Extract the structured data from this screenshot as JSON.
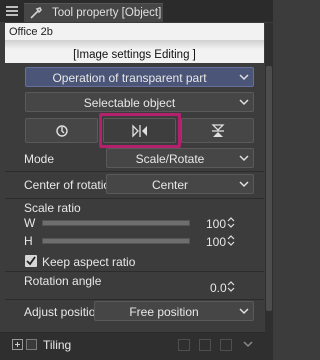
{
  "panel": {
    "tab_title": "Tool property [Object]",
    "preview_name": "Office 2b",
    "preview_caption": "[Image settings Editing ]"
  },
  "operation": {
    "label": "Operation of transparent part"
  },
  "selectable": {
    "label": "Selectable object"
  },
  "mode": {
    "label": "Mode",
    "value": "Scale/Rotate"
  },
  "center": {
    "label": "Center of rotation",
    "value": "Center"
  },
  "scale": {
    "label": "Scale ratio",
    "w_label": "W",
    "w_value": "100",
    "h_label": "H",
    "h_value": "100",
    "keep_aspect_label": "Keep aspect ratio",
    "keep_aspect_checked": true
  },
  "rotation": {
    "label": "Rotation angle",
    "value": "0.0"
  },
  "adjust": {
    "label": "Adjust position",
    "value": "Free position"
  },
  "tiling": {
    "label": "Tiling"
  },
  "colors": {
    "accent": "#4a5577",
    "highlight": "#b5206e"
  }
}
